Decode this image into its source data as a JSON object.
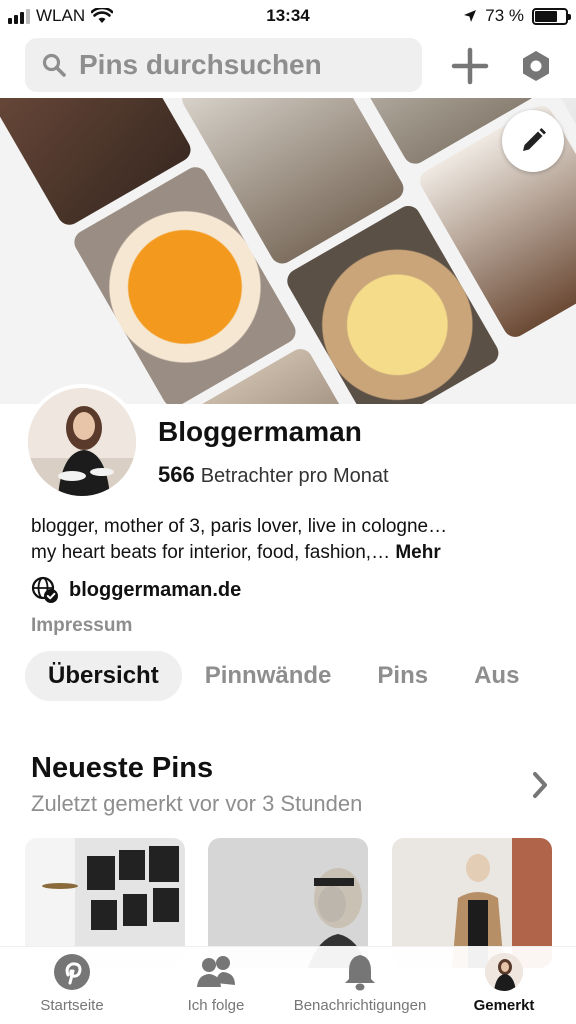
{
  "status_bar": {
    "carrier": "WLAN",
    "time": "13:34",
    "battery": "73 %",
    "battery_level": 0.73
  },
  "topbar": {
    "search_placeholder": "Pins durchsuchen",
    "icons": {
      "search": "search-icon",
      "add": "plus-icon",
      "settings": "hexagon-settings-icon"
    }
  },
  "cover": {
    "edit_icon": "pencil-icon"
  },
  "profile": {
    "name": "Bloggermaman",
    "viewer_count": "566",
    "viewer_label": "Betrachter pro Monat",
    "bio_line1": "blogger, mother of 3, paris lover, live in cologne…",
    "bio_line2": "my heart beats for interior, food, fashion,…",
    "bio_more": "Mehr",
    "website": "bloggermaman.de",
    "impressum": "Impressum"
  },
  "tabs": [
    {
      "label": "Übersicht",
      "active": true
    },
    {
      "label": "Pinnwände",
      "active": false
    },
    {
      "label": "Pins",
      "active": false
    },
    {
      "label": "Aus",
      "active": false
    }
  ],
  "recent": {
    "title": "Neueste Pins",
    "subtitle": "Zuletzt gemerkt vor vor 3 Stunden"
  },
  "bottom_nav": [
    {
      "label": "Startseite",
      "icon": "pinterest-logo-icon",
      "active": false
    },
    {
      "label": "Ich folge",
      "icon": "people-icon",
      "active": false
    },
    {
      "label": "Benachrichtigungen",
      "icon": "bell-icon",
      "active": false
    },
    {
      "label": "Gemerkt",
      "icon": "avatar",
      "active": true
    }
  ],
  "colors": {
    "pinterest_red": "#e60023",
    "text_primary": "#111111",
    "text_secondary": "#8e8e8e",
    "chip_bg": "#efefef"
  }
}
